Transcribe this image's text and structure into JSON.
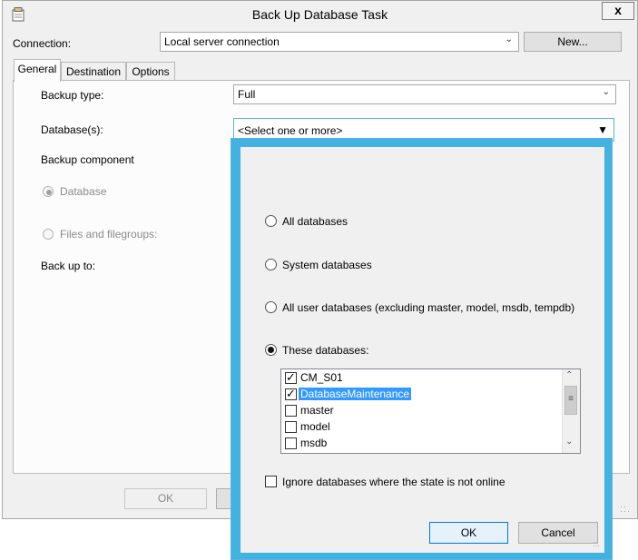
{
  "window": {
    "title": "Back Up Database Task",
    "close_label": "x"
  },
  "connection": {
    "label": "Connection:",
    "value": "Local server connection",
    "new_button": "New..."
  },
  "tabs": [
    {
      "label": "General",
      "active": true
    },
    {
      "label": "Destination",
      "active": false
    },
    {
      "label": "Options",
      "active": false
    }
  ],
  "general": {
    "backup_type_label": "Backup type:",
    "backup_type_value": "Full",
    "databases_label": "Database(s):",
    "databases_value": "<Select one or more>",
    "backup_component_label": "Backup component",
    "component_database": "Database",
    "component_files": "Files and filegroups:",
    "back_up_to_label": "Back up to:"
  },
  "footer": {
    "ok_label": "OK"
  },
  "popup": {
    "options": [
      "All databases",
      "System databases",
      "All user databases  (excluding master, model, msdb, tempdb)",
      "These databases:"
    ],
    "selected_option": 3,
    "databases": [
      {
        "name": "CM_S01",
        "checked": true,
        "highlight": false
      },
      {
        "name": "DatabaseMaintenance",
        "checked": true,
        "highlight": true
      },
      {
        "name": "master",
        "checked": false,
        "highlight": false
      },
      {
        "name": "model",
        "checked": false,
        "highlight": false
      },
      {
        "name": "msdb",
        "checked": false,
        "highlight": false
      }
    ],
    "ignore_offline_label": "Ignore databases where the state is not online",
    "ok_label": "OK",
    "cancel_label": "Cancel"
  },
  "colors": {
    "popup_border": "#42b3e0",
    "selection": "#3399ff"
  }
}
